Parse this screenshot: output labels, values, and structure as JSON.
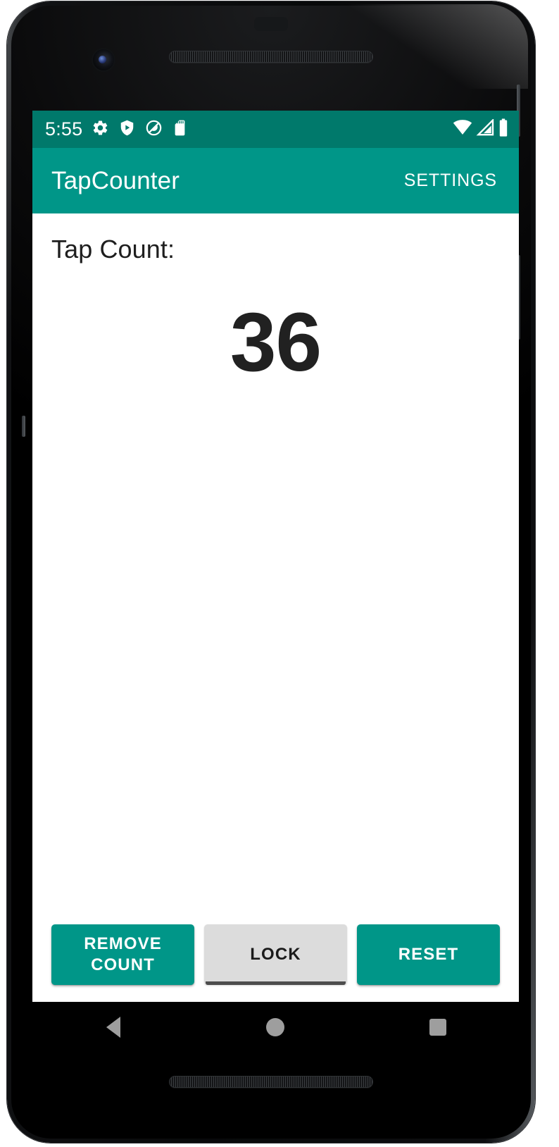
{
  "device": {
    "hardware": {
      "front_camera": "front-camera",
      "earpiece_speaker": "earpiece-speaker",
      "proximity_sensor": "proximity-sensor",
      "bottom_speaker": "bottom-speaker",
      "power_button": "power-button",
      "volume_button": "volume-button"
    }
  },
  "status_bar": {
    "clock": "5:55",
    "background": "#00796b",
    "left_icons": [
      {
        "name": "gear-icon",
        "label": "settings"
      },
      {
        "name": "shield-play-icon",
        "label": "play-protect"
      },
      {
        "name": "circle-slash-icon",
        "label": "do-not-disturb"
      },
      {
        "name": "sd-card-icon",
        "label": "sd-card"
      }
    ],
    "right_icons": [
      {
        "name": "wifi-icon",
        "label": "wifi"
      },
      {
        "name": "cellular-signal-icon",
        "label": "cellular"
      },
      {
        "name": "battery-icon",
        "label": "battery-full"
      }
    ]
  },
  "app_bar": {
    "title": "TapCounter",
    "action_label": "SETTINGS",
    "background": "#009688",
    "text_color": "#ffffff"
  },
  "content": {
    "label": "Tap Count:",
    "count": "36",
    "count_color": "#212121",
    "background": "#ffffff"
  },
  "buttons": [
    {
      "label": "REMOVE COUNT",
      "style": "primary",
      "name": "remove-count-button",
      "color": "#009688"
    },
    {
      "label": "LOCK",
      "style": "neutral",
      "name": "lock-button",
      "color": "#dcdcdc"
    },
    {
      "label": "RESET",
      "style": "primary",
      "name": "reset-button",
      "color": "#009688"
    }
  ],
  "nav_bar": {
    "background": "#000000",
    "items": [
      {
        "name": "nav-back-icon",
        "label": "Back"
      },
      {
        "name": "nav-home-icon",
        "label": "Home"
      },
      {
        "name": "nav-recents-icon",
        "label": "Recents"
      }
    ]
  }
}
